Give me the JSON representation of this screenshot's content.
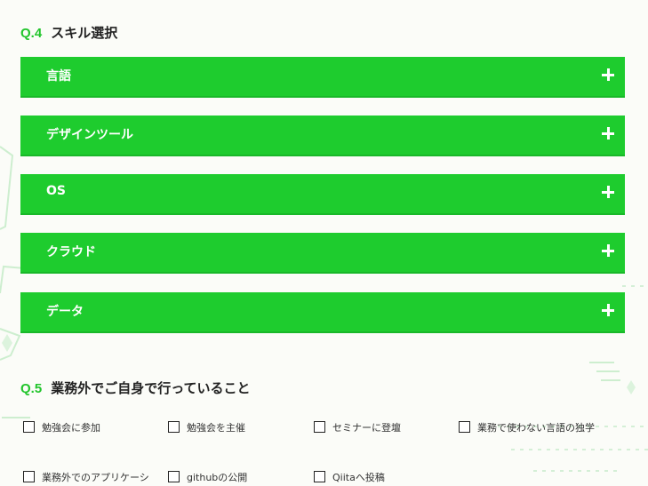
{
  "q4": {
    "number": "Q.4",
    "title": "スキル選択"
  },
  "accordions": [
    {
      "label": "言語"
    },
    {
      "label": "デザインツール"
    },
    {
      "label": "OS"
    },
    {
      "label": "クラウド"
    },
    {
      "label": "データ"
    }
  ],
  "accordion_state": "collapsed",
  "q5": {
    "number": "Q.5",
    "title": "業務外でご自身で行っていること"
  },
  "activities": [
    {
      "label": "勉強会に参加",
      "checked": false
    },
    {
      "label": "勉強会を主催",
      "checked": false
    },
    {
      "label": "セミナーに登壇",
      "checked": false
    },
    {
      "label": "業務で使わない言語の独学",
      "checked": false
    },
    {
      "label": "業務外でのアプリケーシ",
      "checked": false
    },
    {
      "label": "githubの公開",
      "checked": false
    },
    {
      "label": "Qiitaへ投稿",
      "checked": false
    }
  ],
  "colors": {
    "accent": "#1ecc2e",
    "question_number": "#22c52c",
    "background": "#fbfcf8",
    "decoration": "#cdeecf"
  }
}
